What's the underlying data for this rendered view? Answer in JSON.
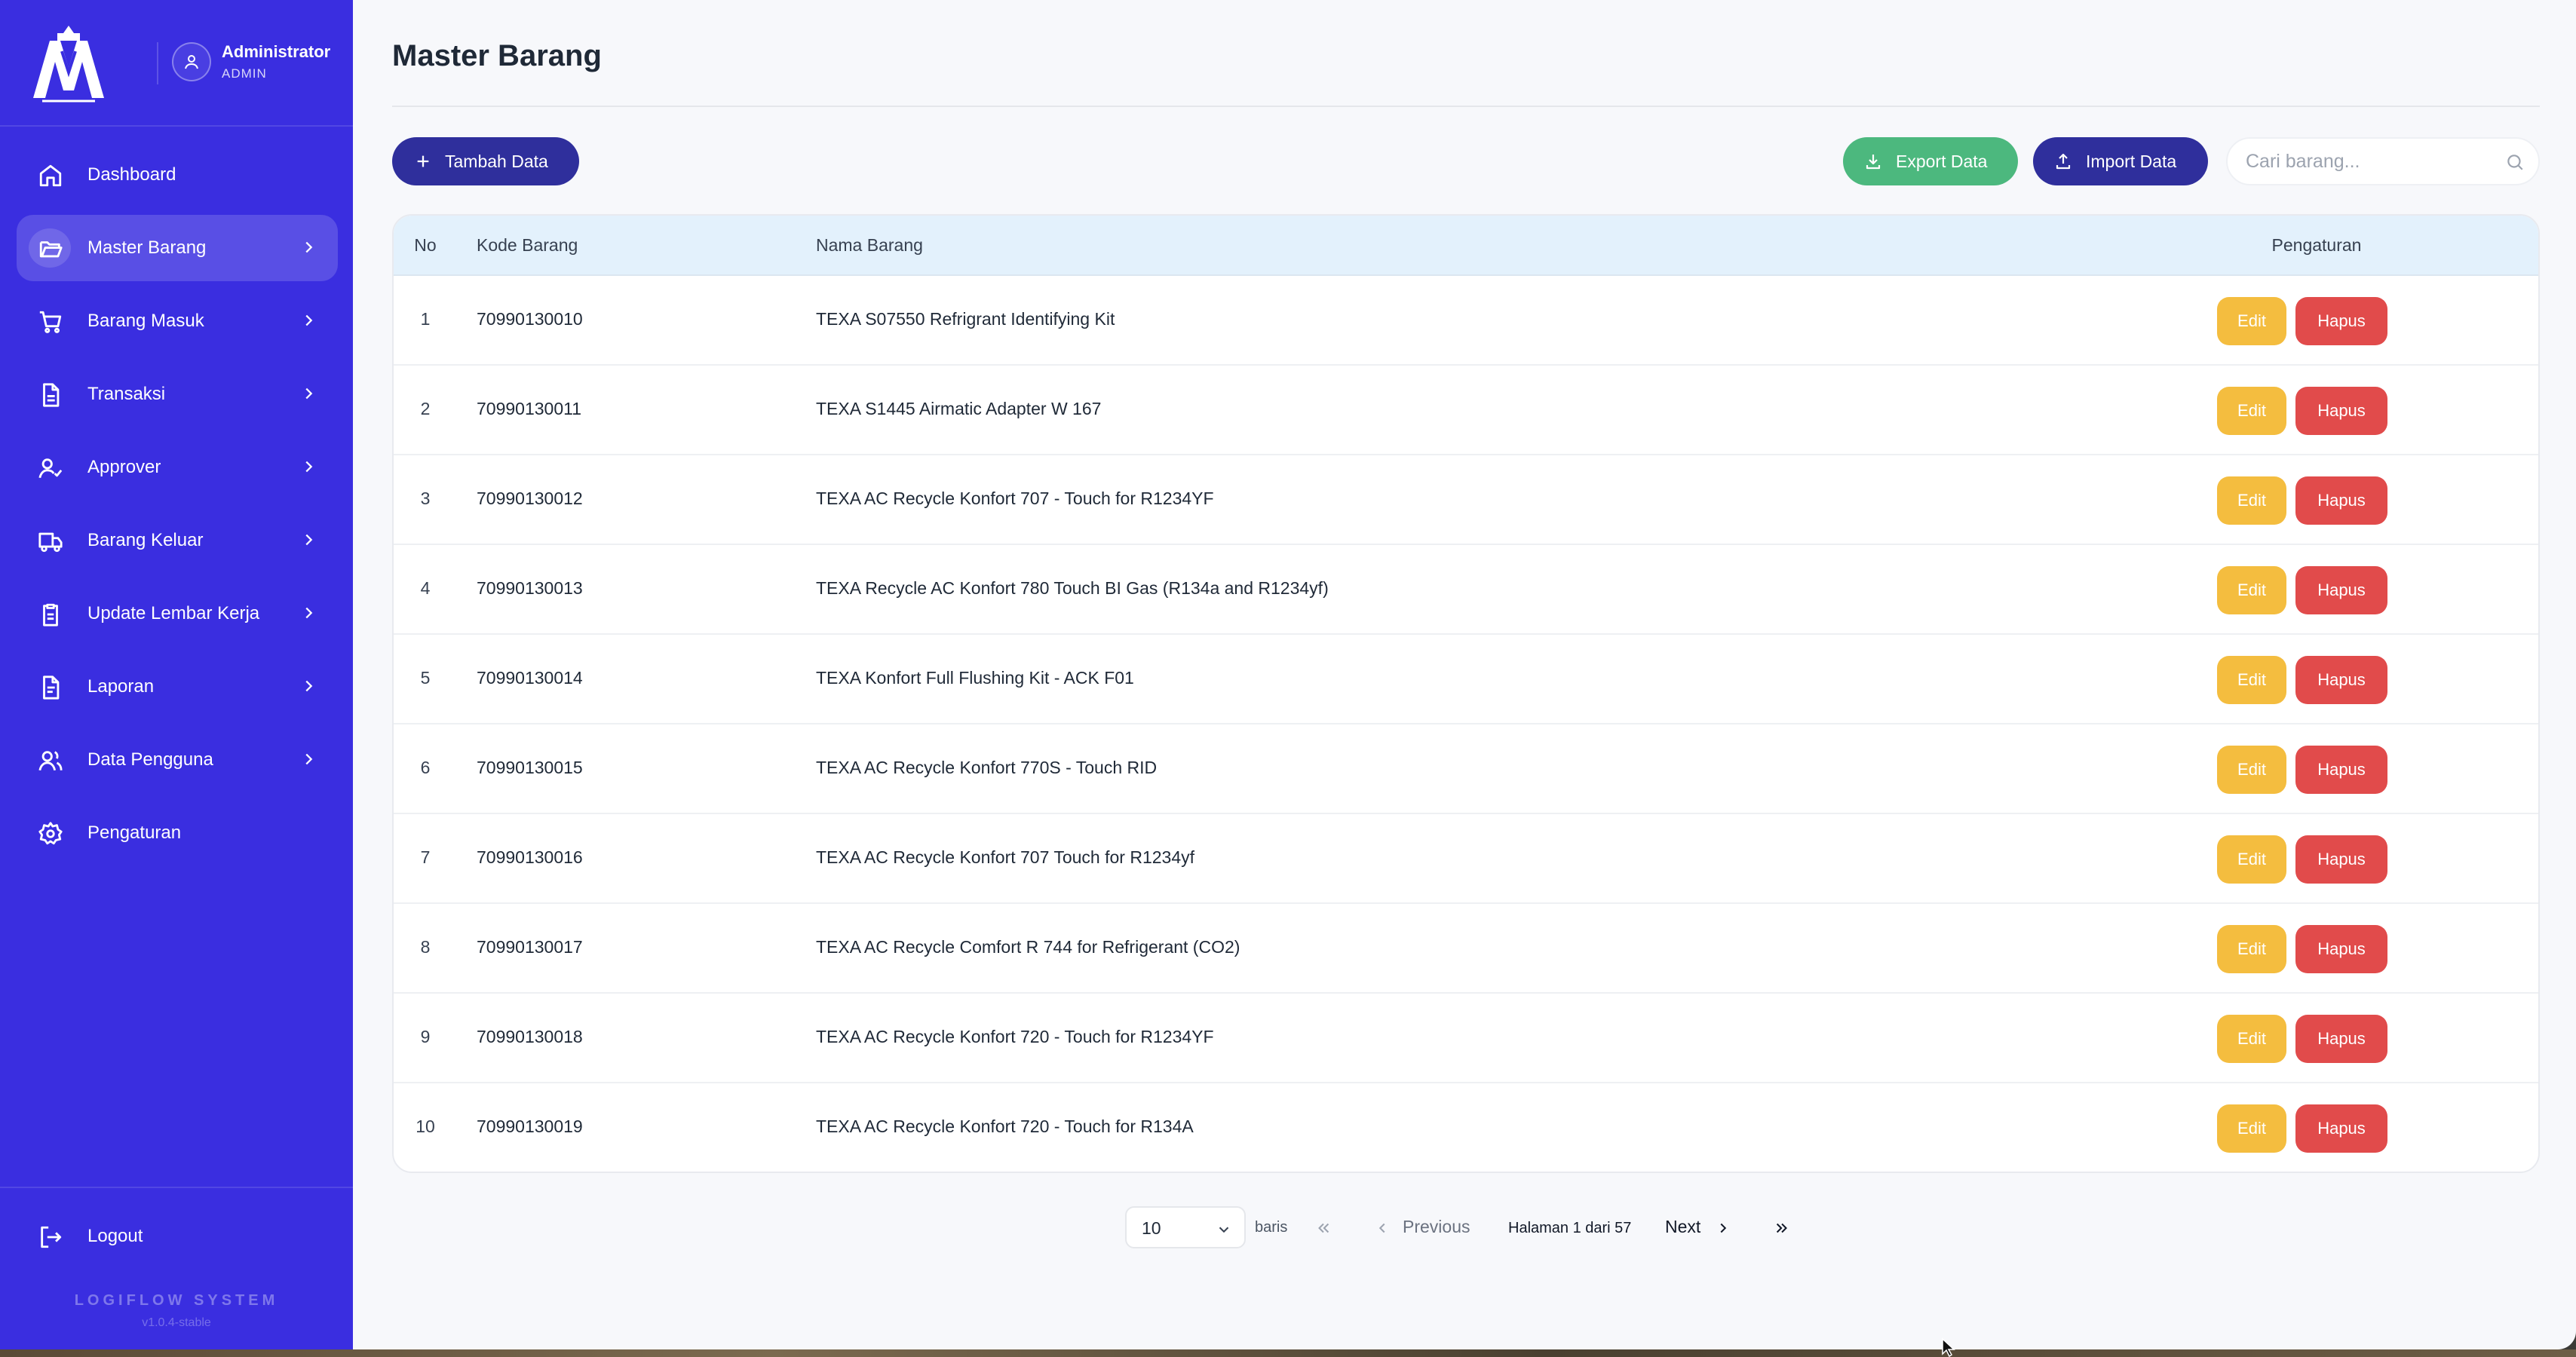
{
  "sidebar": {
    "user": {
      "name": "Administrator",
      "role": "ADMIN"
    },
    "items": [
      {
        "label": "Dashboard",
        "icon": "home-icon",
        "chevron": false
      },
      {
        "label": "Master Barang",
        "icon": "folder-open-icon",
        "chevron": true,
        "active": true
      },
      {
        "label": "Barang Masuk",
        "icon": "cart-icon",
        "chevron": true
      },
      {
        "label": "Transaksi",
        "icon": "file-text-icon",
        "chevron": true
      },
      {
        "label": "Approver",
        "icon": "user-check-icon",
        "chevron": true
      },
      {
        "label": "Barang Keluar",
        "icon": "truck-icon",
        "chevron": true
      },
      {
        "label": "Update Lembar Kerja",
        "icon": "clipboard-icon",
        "chevron": true
      },
      {
        "label": "Laporan",
        "icon": "file-report-icon",
        "chevron": true
      },
      {
        "label": "Data Pengguna",
        "icon": "users-icon",
        "chevron": true
      },
      {
        "label": "Pengaturan",
        "icon": "gear-icon",
        "chevron": false
      }
    ],
    "logout_label": "Logout",
    "system_name": "LOGIFLOW SYSTEM",
    "version": "v1.0.4-stable"
  },
  "page": {
    "title": "Master Barang",
    "add_label": "Tambah Data",
    "export_label": "Export Data",
    "import_label": "Import Data",
    "search_placeholder": "Cari barang..."
  },
  "colors": {
    "sidebar": "#3a2ee0",
    "primary_button": "#2f2f9c",
    "export_button": "#4cb87e",
    "edit_button": "#f4bd3f",
    "delete_button": "#e14b4b",
    "table_header": "#e3f1fc"
  },
  "table": {
    "headers": {
      "no": "No",
      "kode": "Kode Barang",
      "nama": "Nama Barang",
      "pengaturan": "Pengaturan"
    },
    "edit_label": "Edit",
    "delete_label": "Hapus",
    "rows": [
      {
        "no": "1",
        "kode": "70990130010",
        "nama": "TEXA S07550 Refrigrant Identifying Kit"
      },
      {
        "no": "2",
        "kode": "70990130011",
        "nama": "TEXA S1445 Airmatic Adapter W 167"
      },
      {
        "no": "3",
        "kode": "70990130012",
        "nama": "TEXA AC Recycle Konfort 707 - Touch for R1234YF"
      },
      {
        "no": "4",
        "kode": "70990130013",
        "nama": "TEXA Recycle AC Konfort 780 Touch BI Gas (R134a and R1234yf)"
      },
      {
        "no": "5",
        "kode": "70990130014",
        "nama": "TEXA Konfort Full Flushing Kit - ACK F01"
      },
      {
        "no": "6",
        "kode": "70990130015",
        "nama": "TEXA AC Recycle Konfort 770S - Touch RID"
      },
      {
        "no": "7",
        "kode": "70990130016",
        "nama": "TEXA AC Recycle Konfort 707 Touch for R1234yf"
      },
      {
        "no": "8",
        "kode": "70990130017",
        "nama": "TEXA AC Recycle Comfort R 744 for Refrigerant (CO2)"
      },
      {
        "no": "9",
        "kode": "70990130018",
        "nama": "TEXA AC Recycle Konfort 720 - Touch for R1234YF"
      },
      {
        "no": "10",
        "kode": "70990130019",
        "nama": "TEXA AC Recycle Konfort 720 - Touch for R134A"
      }
    ]
  },
  "pagination": {
    "page_size": "10",
    "rows_label": "baris",
    "previous_label": "Previous",
    "page_info": "Halaman 1 dari 57",
    "next_label": "Next"
  }
}
